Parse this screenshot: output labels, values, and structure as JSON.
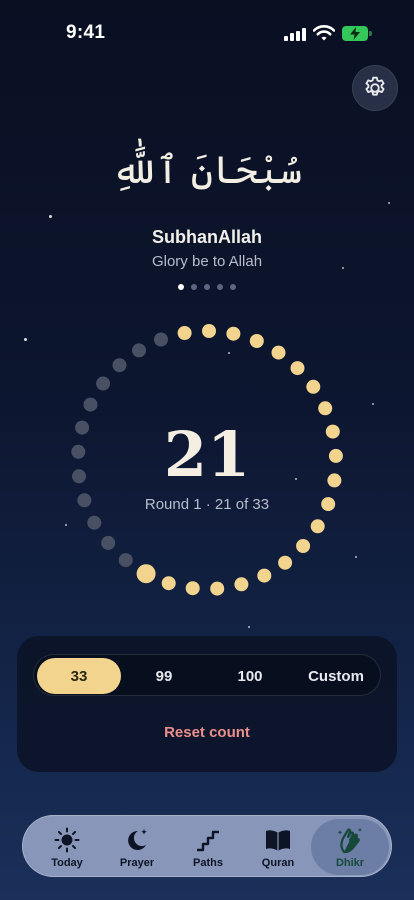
{
  "status_bar": {
    "time": "9:41",
    "icons": [
      "signal-icon",
      "wifi-icon",
      "battery-charging-icon"
    ]
  },
  "header": {
    "settings_icon": "gear-icon"
  },
  "dhikr": {
    "arabic": "سُبْحَانَ ٱللَّٰهِ",
    "transliteration": "SubhanAllah",
    "meaning": "Glory be to Allah",
    "page_count": 5,
    "page_active": 0
  },
  "counter": {
    "count": "21",
    "round_text": "Round 1 · 21 of 33",
    "total_beads": 33,
    "filled_beads": 21,
    "colors": {
      "filled": "#f3d48e",
      "empty": "#4a5064"
    }
  },
  "controls": {
    "options": [
      "33",
      "99",
      "100",
      "Custom"
    ],
    "selected": "33",
    "reset_label": "Reset count"
  },
  "tabs": [
    {
      "label": "Today",
      "icon": "sun-icon"
    },
    {
      "label": "Prayer",
      "icon": "moon-stars-icon"
    },
    {
      "label": "Paths",
      "icon": "stairs-icon"
    },
    {
      "label": "Quran",
      "icon": "book-icon"
    },
    {
      "label": "Dhikr",
      "icon": "praying-hands-icon",
      "active": true
    }
  ],
  "colors": {
    "accent": "#f3d48e",
    "reset": "#ec8f8c",
    "active_tab_text": "#16493a"
  }
}
